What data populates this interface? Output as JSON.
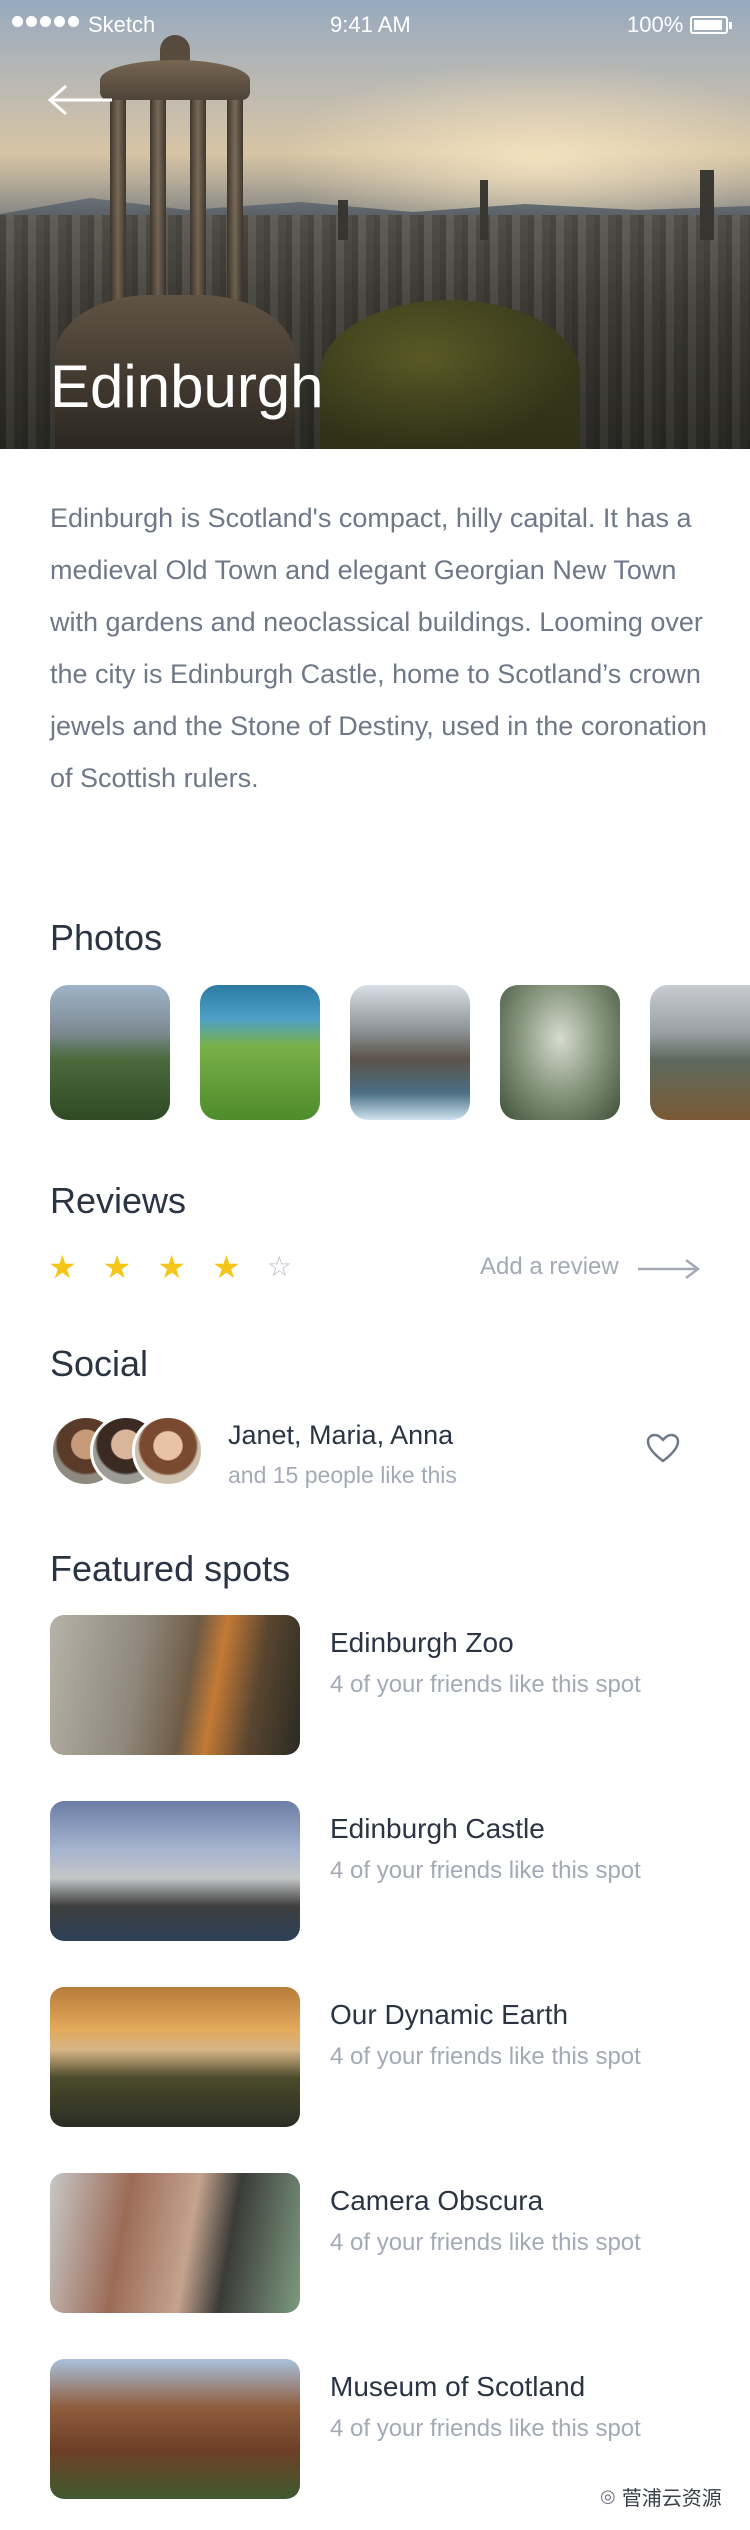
{
  "status_bar": {
    "carrier": "Sketch",
    "time": "9:41 AM",
    "battery": "100%"
  },
  "hero": {
    "title": "Edinburgh"
  },
  "description": "Edinburgh is Scotland's compact, hilly capital. It has a medieval Old Town and elegant Georgian New Town with gardens and neoclassical buildings. Looming over the city is Edinburgh Castle, home to Scotland’s crown jewels and the Stone of Destiny, used in the coronation of Scottish rulers.",
  "photos": {
    "title": "Photos"
  },
  "reviews": {
    "title": "Reviews",
    "rating": 4,
    "max_rating": 5,
    "add_label": "Add a review"
  },
  "social": {
    "title": "Social",
    "names": "Janet, Maria, Anna",
    "subtitle": "and 15 people like this"
  },
  "featured": {
    "title": "Featured spots",
    "spots": [
      {
        "name": "Edinburgh Zoo",
        "subtitle": "4 of your friends like this spot"
      },
      {
        "name": "Edinburgh Castle",
        "subtitle": "4 of your friends like this spot"
      },
      {
        "name": "Our Dynamic Earth",
        "subtitle": "4 of your friends like this spot"
      },
      {
        "name": "Camera Obscura",
        "subtitle": "4 of your friends like this spot"
      },
      {
        "name": "Museum of Scotland",
        "subtitle": "4 of your friends like this spot"
      }
    ]
  },
  "watermark": "菅浦云资源",
  "colors": {
    "star": "#f5c518",
    "text_primary": "#2b3443",
    "text_secondary": "#a3aab6"
  }
}
